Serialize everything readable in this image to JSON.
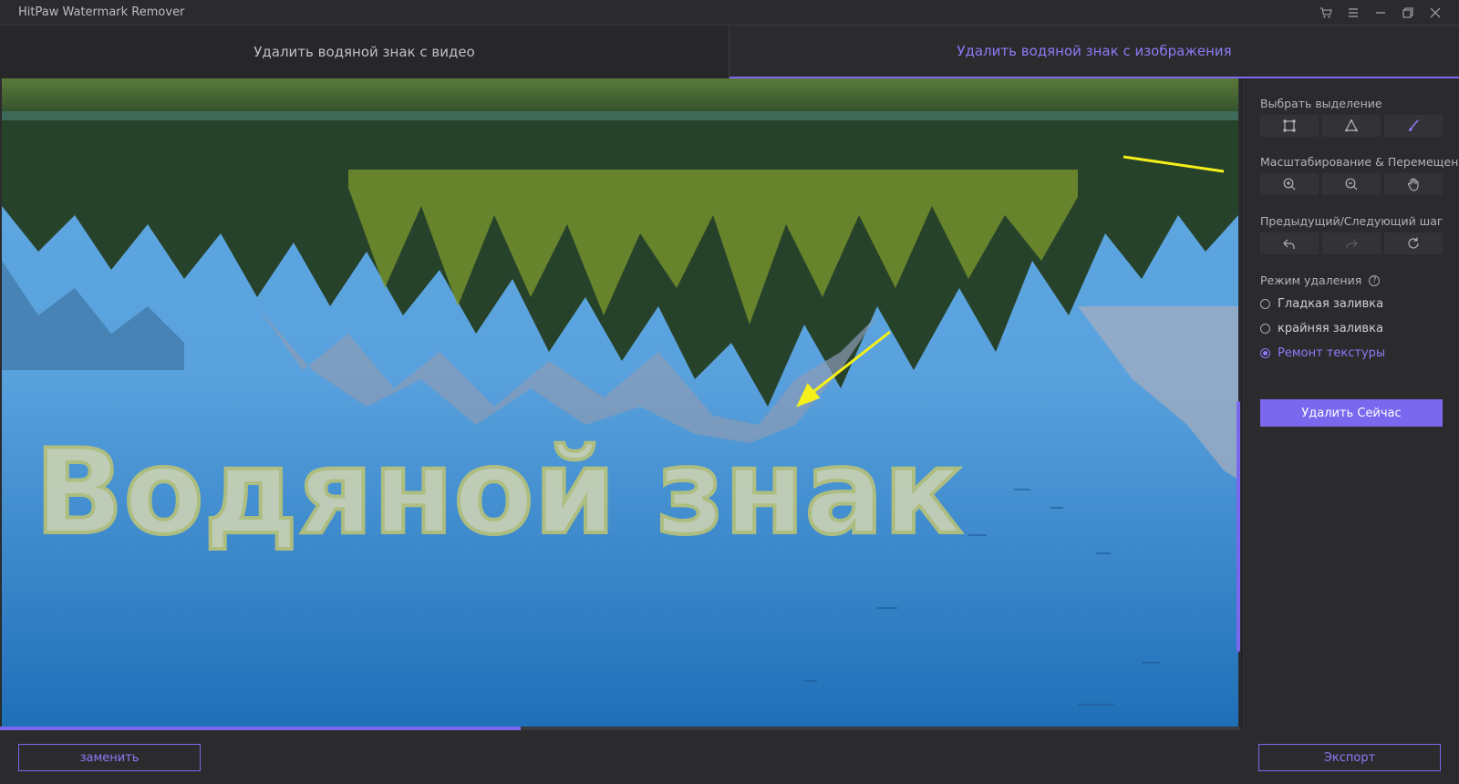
{
  "window": {
    "title": "HitPaw Watermark Remover",
    "controls": [
      "cart-icon",
      "menu-icon",
      "minimize-icon",
      "restore-icon",
      "close-icon"
    ]
  },
  "tabs": [
    {
      "label": "Удалить водяной знак с видео",
      "active": false
    },
    {
      "label": "Удалить водяной знак с изображения",
      "active": true
    }
  ],
  "canvas": {
    "watermark_text": "Водяной знак",
    "progress": 0.42
  },
  "panel": {
    "selection": {
      "label": "Выбрать выделение",
      "tools": [
        "rectangle-select-icon",
        "polygon-lasso-icon",
        "brush-icon"
      ]
    },
    "zoom": {
      "label": "Масштабирование & Перемещение",
      "tools": [
        "zoom-in-icon",
        "zoom-out-icon",
        "hand-pan-icon"
      ]
    },
    "history": {
      "label": "Предыдущий/Следующий шаг",
      "tools": [
        "undo-icon",
        "redo-icon",
        "reset-icon"
      ]
    },
    "mode": {
      "label": "Режим удаления",
      "help": "?",
      "options": [
        {
          "label": "Гладкая заливка",
          "checked": false
        },
        {
          "label": "крайняя заливка",
          "checked": false
        },
        {
          "label": "Ремонт текстуры",
          "checked": true
        }
      ]
    },
    "remove_button": "Удалить Сейчас"
  },
  "bottom": {
    "replace_button": "заменить",
    "export_button": "Экспорт"
  },
  "colors": {
    "accent": "#7a68ee",
    "accent_text": "#8b7bf5",
    "background": "#2b2b2e"
  }
}
